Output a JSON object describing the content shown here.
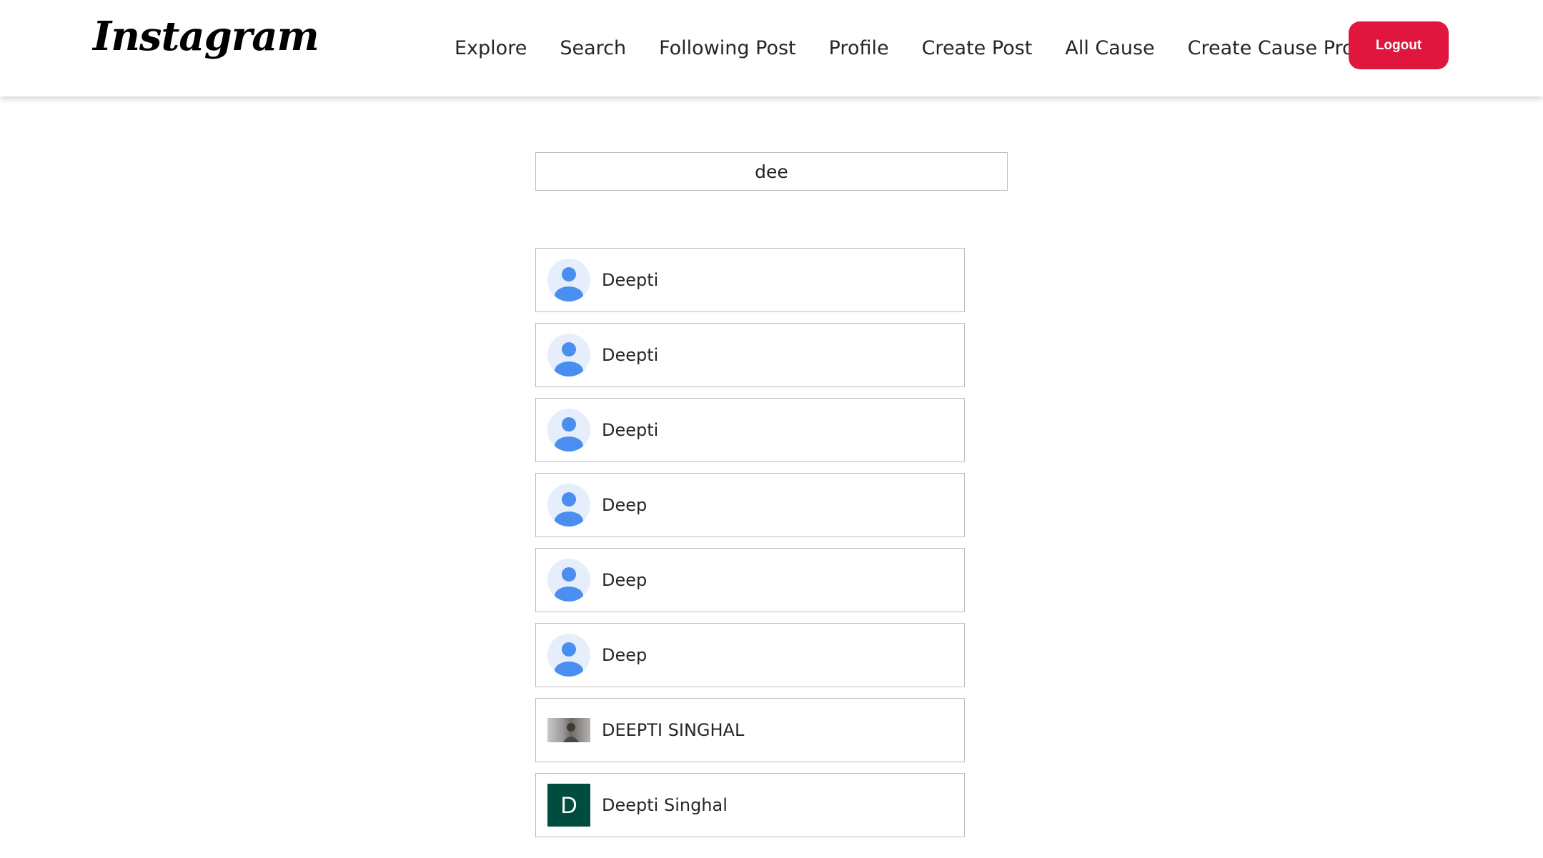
{
  "header": {
    "brand": "Instagram",
    "nav": [
      "Explore",
      "Search",
      "Following Post",
      "Profile",
      "Create Post",
      "All Cause",
      "Create Cause Profile"
    ],
    "chat_icon": "chat-icon",
    "logout_label": "Logout"
  },
  "colors": {
    "accent": "#e0163f",
    "avatar_blue": "#4a8ef0",
    "avatar_bg": "#e6eefc",
    "letter_avatar_bg": "#004d40"
  },
  "search": {
    "value": "dee"
  },
  "results": [
    {
      "name": "Deepti",
      "avatar": "default"
    },
    {
      "name": "Deepti",
      "avatar": "default"
    },
    {
      "name": "Deepti",
      "avatar": "default"
    },
    {
      "name": "Deep",
      "avatar": "default"
    },
    {
      "name": "Deep",
      "avatar": "default"
    },
    {
      "name": "Deep",
      "avatar": "default"
    },
    {
      "name": "DEEPTI SINGHAL",
      "avatar": "photo"
    },
    {
      "name": "Deepti Singhal",
      "avatar": "letter",
      "letter": "D"
    }
  ]
}
